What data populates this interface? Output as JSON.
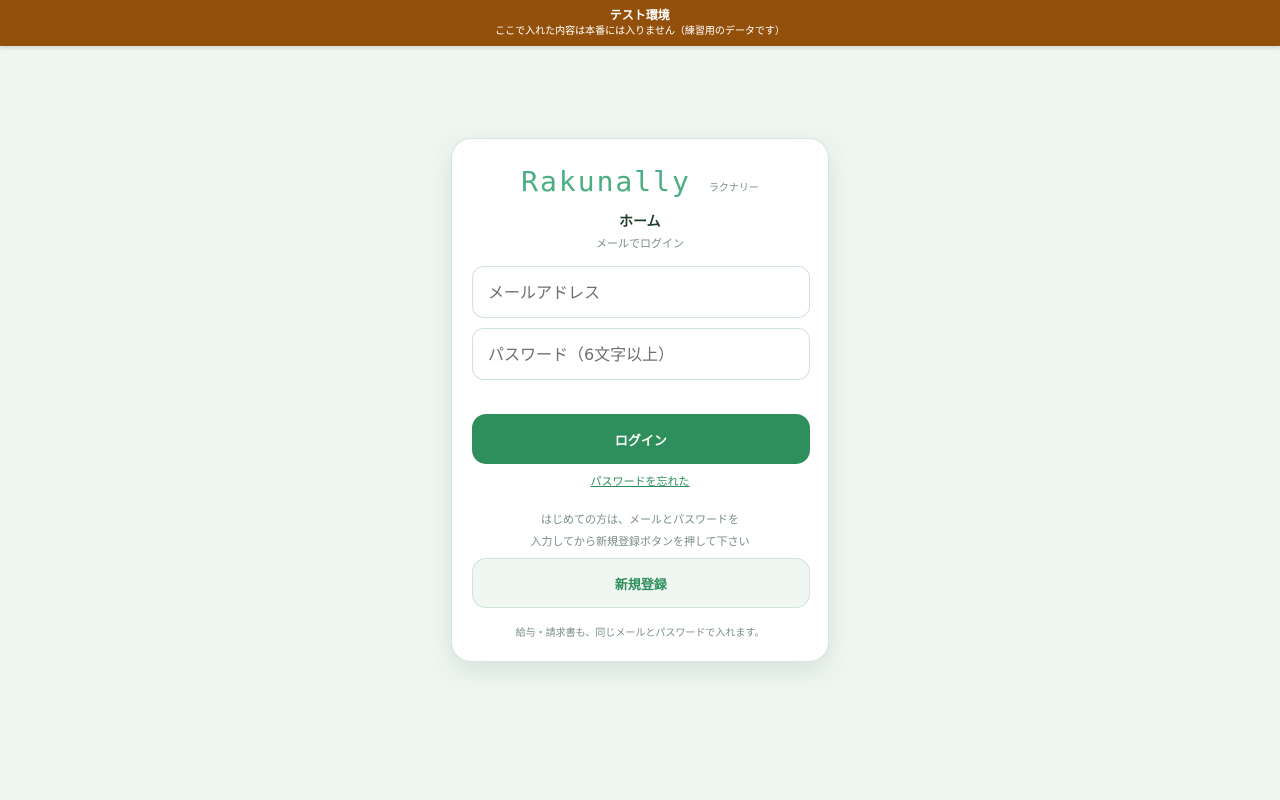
{
  "env_banner": {
    "title": "テスト環境",
    "subtitle": "ここで入れた内容は本番には入りません（練習用のデータです）"
  },
  "brand": {
    "name": "Rakunally",
    "kana": "ラクナリー"
  },
  "screen": {
    "title": "ホーム",
    "subtitle": "メールでログイン"
  },
  "form": {
    "email_placeholder": "メールアドレス",
    "email_value": "",
    "password_placeholder": "パスワード（6文字以上）",
    "password_value": "",
    "login_label": "ログイン",
    "forgot_label": "パスワードを忘れた"
  },
  "signup": {
    "note_line1": "はじめての方は、メールとパスワードを",
    "note_line2": "入力してから新規登録ボタンを押して下さい",
    "register_label": "新規登録"
  },
  "footnote": "給与・請求書も、同じメールとパスワードで入れます。",
  "colors": {
    "banner": "#93500b",
    "accent": "#2e8f5c",
    "brand": "#4cae82",
    "background": "#eef6f1"
  }
}
